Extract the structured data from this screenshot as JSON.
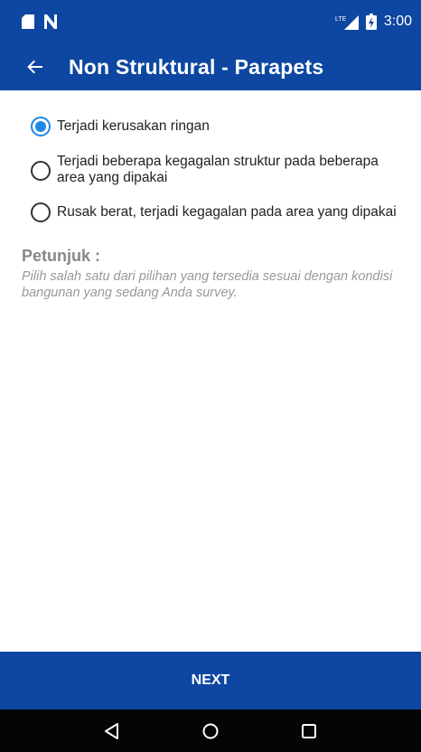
{
  "status_bar": {
    "time": "3:00",
    "network_label": "LTE",
    "icons": [
      "sd-card-icon",
      "n-icon",
      "lte-signal-icon",
      "battery-icon"
    ]
  },
  "app_bar": {
    "title": "Non Struktural - Parapets",
    "back_icon": "arrow-left-icon"
  },
  "options": [
    {
      "label": "Terjadi kerusakan ringan",
      "selected": true
    },
    {
      "label": "Terjadi beberapa kegagalan struktur pada beberapa area yang dipakai",
      "selected": false
    },
    {
      "label": "Rusak berat, terjadi kegagalan pada area yang dipakai",
      "selected": false
    }
  ],
  "hint": {
    "title": "Petunjuk :",
    "text": "Pilih salah satu dari pilihan yang tersedia sesuai dengan kondisi bangunan yang sedang Anda survey."
  },
  "next_button": {
    "label": "NEXT"
  },
  "nav_bar": {
    "buttons": [
      "back-triangle-icon",
      "home-circle-icon",
      "recents-square-icon"
    ]
  },
  "colors": {
    "primary": "#0d47a1",
    "accent": "#1e88e5",
    "hint_text": "#999999"
  }
}
